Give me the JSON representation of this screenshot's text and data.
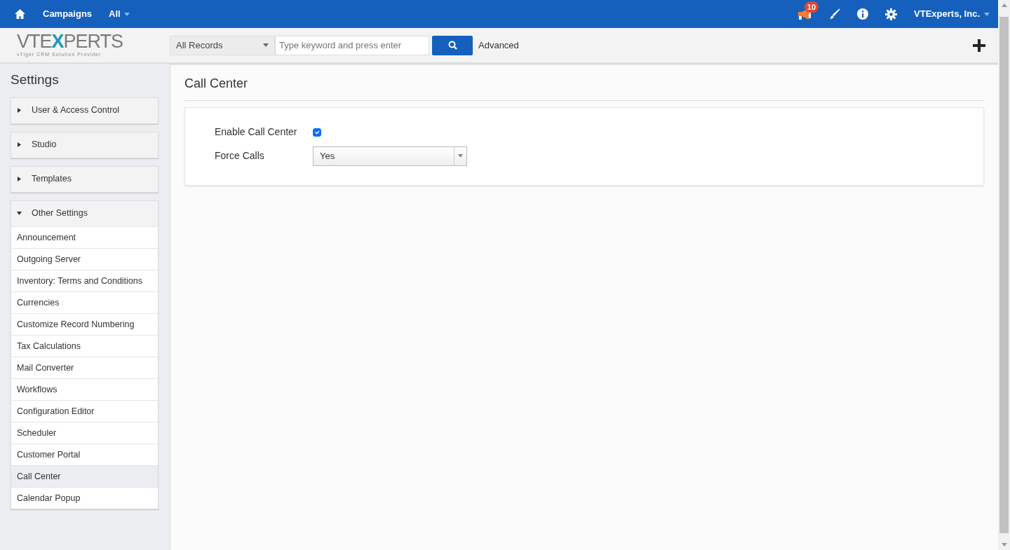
{
  "topbar": {
    "module": "Campaigns",
    "filter": "All",
    "notification_count": "10",
    "account": "VTExperts, Inc."
  },
  "logo": {
    "before": "VTE",
    "accent": "X",
    "after": "PERTS",
    "tagline": "vTiger CRM Solution Provider"
  },
  "search": {
    "scope": "All Records",
    "placeholder": "Type keyword and press enter",
    "advanced": "Advanced"
  },
  "sidebar": {
    "title": "Settings",
    "groups": [
      {
        "label": "User & Access Control",
        "expanded": false
      },
      {
        "label": "Studio",
        "expanded": false
      },
      {
        "label": "Templates",
        "expanded": false
      },
      {
        "label": "Other Settings",
        "expanded": true,
        "items": [
          {
            "label": "Announcement",
            "selected": false
          },
          {
            "label": "Outgoing Server",
            "selected": false
          },
          {
            "label": "Inventory: Terms and Conditions",
            "selected": false
          },
          {
            "label": "Currencies",
            "selected": false
          },
          {
            "label": "Customize Record Numbering",
            "selected": false
          },
          {
            "label": "Tax Calculations",
            "selected": false
          },
          {
            "label": "Mail Converter",
            "selected": false
          },
          {
            "label": "Workflows",
            "selected": false
          },
          {
            "label": "Configuration Editor",
            "selected": false
          },
          {
            "label": "Scheduler",
            "selected": false
          },
          {
            "label": "Customer Portal",
            "selected": false
          },
          {
            "label": "Call Center",
            "selected": true
          },
          {
            "label": "Calendar Popup",
            "selected": false
          }
        ]
      }
    ]
  },
  "page": {
    "title": "Call Center",
    "fields": [
      {
        "kind": "checkbox",
        "label": "Enable Call Center",
        "checked": true
      },
      {
        "kind": "select",
        "label": "Force Calls",
        "value": "Yes"
      }
    ]
  }
}
